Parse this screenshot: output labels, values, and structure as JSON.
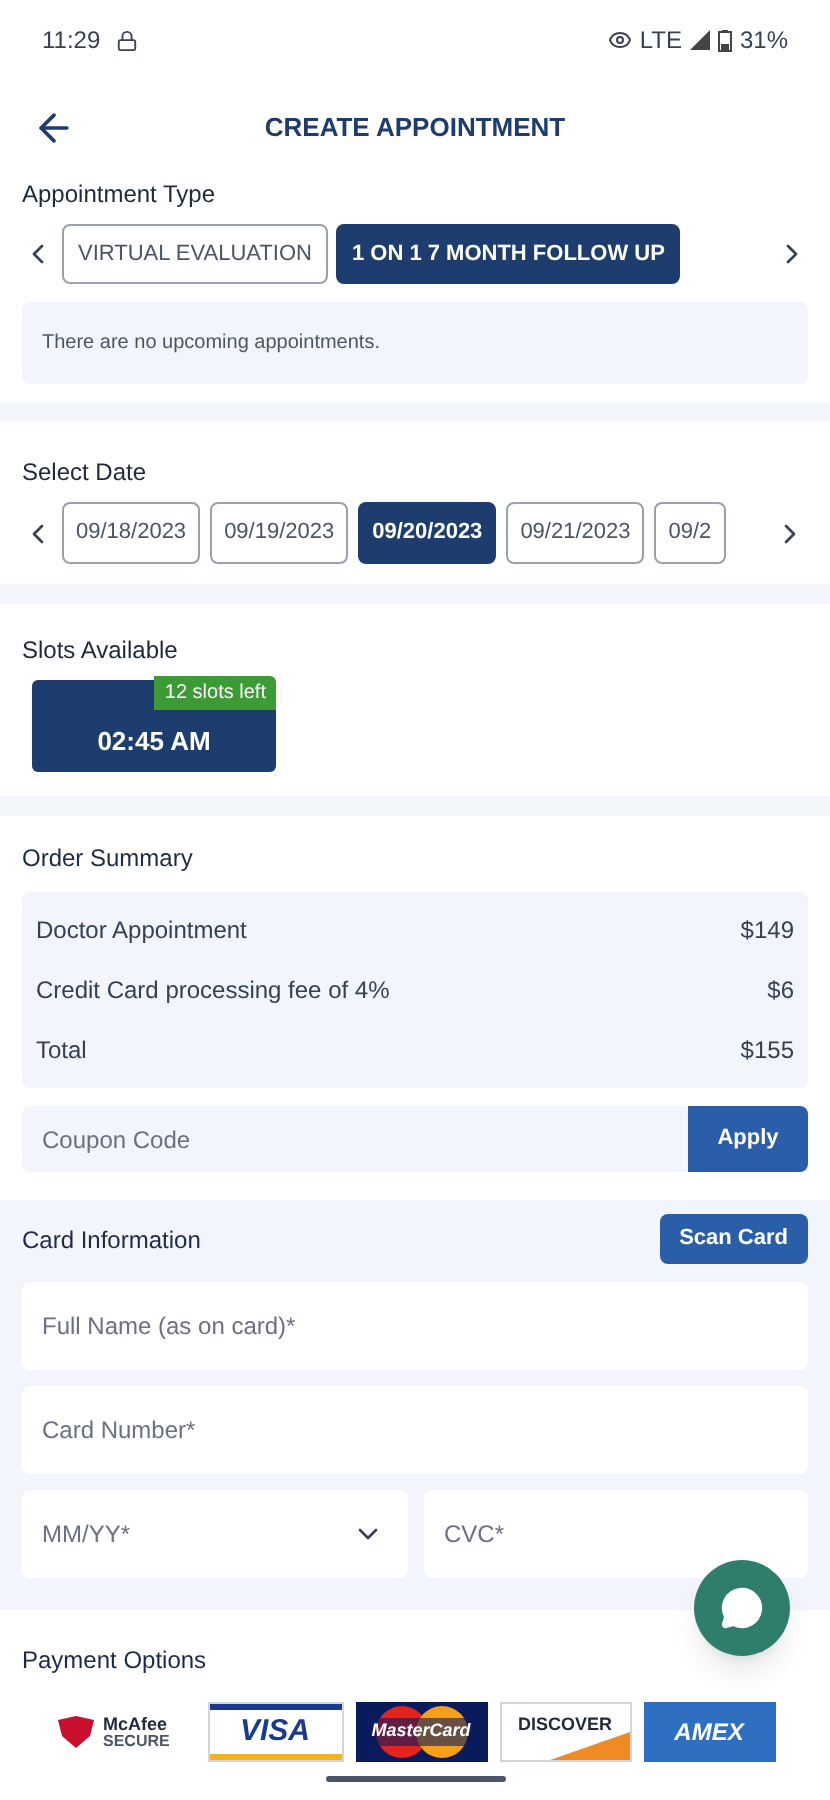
{
  "status_bar": {
    "time": "11:29",
    "network": "LTE",
    "battery": "31%"
  },
  "header": {
    "title": "CREATE APPOINTMENT"
  },
  "appointment_type": {
    "label": "Appointment Type",
    "options": [
      {
        "label": "VIRTUAL EVALUATION",
        "selected": false
      },
      {
        "label": "1 ON 1 7 MONTH FOLLOW UP",
        "selected": true
      }
    ],
    "message": "There are no upcoming appointments."
  },
  "select_date": {
    "label": "Select Date",
    "dates": [
      {
        "label": "09/18/2023",
        "selected": false
      },
      {
        "label": "09/19/2023",
        "selected": false
      },
      {
        "label": "09/20/2023",
        "selected": true
      },
      {
        "label": "09/21/2023",
        "selected": false
      },
      {
        "label": "09/2",
        "selected": false
      }
    ]
  },
  "slots": {
    "label": "Slots Available",
    "items": [
      {
        "time": "02:45 AM",
        "badge": "12 slots left",
        "selected": true
      }
    ]
  },
  "order_summary": {
    "label": "Order Summary",
    "rows": [
      {
        "item": "Doctor Appointment",
        "amount": "$149"
      },
      {
        "item": "Credit Card processing fee of 4%",
        "amount": "$6"
      },
      {
        "item": "Total",
        "amount": "$155"
      }
    ],
    "coupon": {
      "placeholder": "Coupon Code"
    },
    "apply_button": "Apply"
  },
  "card_information": {
    "label": "Card Information",
    "scan_button": "Scan Card",
    "fields": [
      {
        "kind": "text",
        "placeholder": "Full Name (as on card)*"
      },
      {
        "kind": "text",
        "placeholder": "Card Number*"
      }
    ],
    "expiry": {
      "placeholder": "MM/YY*"
    },
    "cvc": {
      "placeholder": "CVC*"
    }
  },
  "payment_options": {
    "label": "Payment Options",
    "logos": [
      {
        "kind": "mcafee",
        "text": "McAfee",
        "subtext": "SECURE"
      },
      {
        "kind": "visa",
        "text": "VISA"
      },
      {
        "kind": "mastercard",
        "text": "MasterCard"
      },
      {
        "kind": "discover",
        "text": "DISCOVER"
      },
      {
        "kind": "amex",
        "text": "AMEX"
      }
    ]
  }
}
